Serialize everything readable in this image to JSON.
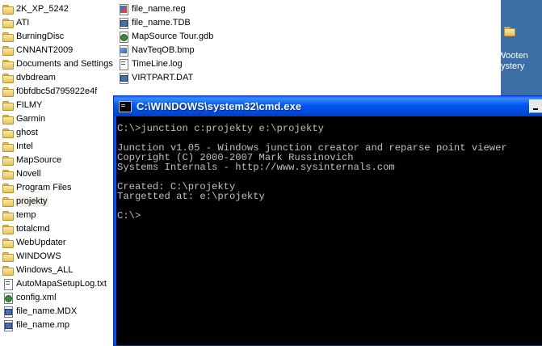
{
  "explorer": {
    "col1": [
      {
        "name": "2K_XP_5242",
        "type": "folder"
      },
      {
        "name": "ATI",
        "type": "folder"
      },
      {
        "name": "BurningDisc",
        "type": "folder"
      },
      {
        "name": "CNNANT2009",
        "type": "folder"
      },
      {
        "name": "Documents and Settings",
        "type": "folder"
      },
      {
        "name": "dvbdream",
        "type": "folder"
      },
      {
        "name": "f0bfdbc5d795922e4f",
        "type": "folder"
      },
      {
        "name": "FILMY",
        "type": "folder"
      },
      {
        "name": "Garmin",
        "type": "folder"
      },
      {
        "name": "ghost",
        "type": "folder"
      },
      {
        "name": "Intel",
        "type": "folder"
      },
      {
        "name": "MapSource",
        "type": "folder"
      },
      {
        "name": "Novell",
        "type": "folder"
      },
      {
        "name": "Program Files",
        "type": "folder"
      },
      {
        "name": "projekty",
        "type": "folder",
        "selected": true
      },
      {
        "name": "temp",
        "type": "folder"
      },
      {
        "name": "totalcmd",
        "type": "folder"
      },
      {
        "name": "WebUpdater",
        "type": "folder"
      },
      {
        "name": "WINDOWS",
        "type": "folder"
      },
      {
        "name": "Windows_ALL",
        "type": "folder"
      },
      {
        "name": "AutoMapaSetupLog.txt",
        "type": "txt"
      },
      {
        "name": "config.xml",
        "type": "gear"
      },
      {
        "name": "file_name.MDX",
        "type": "db"
      },
      {
        "name": "file_name.mp",
        "type": "db"
      }
    ],
    "col2": [
      {
        "name": "file_name.reg",
        "type": "reg"
      },
      {
        "name": "file_name.TDB",
        "type": "db"
      },
      {
        "name": "MapSource Tour.gdb",
        "type": "gear"
      },
      {
        "name": "NavTeqOB.bmp",
        "type": "img"
      },
      {
        "name": "TimeLine.log",
        "type": "txt"
      },
      {
        "name": "VIRTPART.DAT",
        "type": "db"
      }
    ]
  },
  "desktop": {
    "label_line1": "Wooten",
    "label_line2": "ystery"
  },
  "cmd": {
    "title": "C:\\WINDOWS\\system32\\cmd.exe",
    "lines": [
      "C:\\>junction c:projekty e:\\projekty",
      "",
      "Junction v1.05 - Windows junction creator and reparse point viewer",
      "Copyright (C) 2000-2007 Mark Russinovich",
      "Systems Internals - http://www.sysinternals.com",
      "",
      "Created: C:\\projekty",
      "Targetted at: e:\\projekty",
      "",
      "C:\\>"
    ]
  },
  "colors": {
    "desktop_bg": "#3a6ea5",
    "titlebar": "#0054e3",
    "console_bg": "#000000",
    "console_fg": "#c0c0c0"
  }
}
